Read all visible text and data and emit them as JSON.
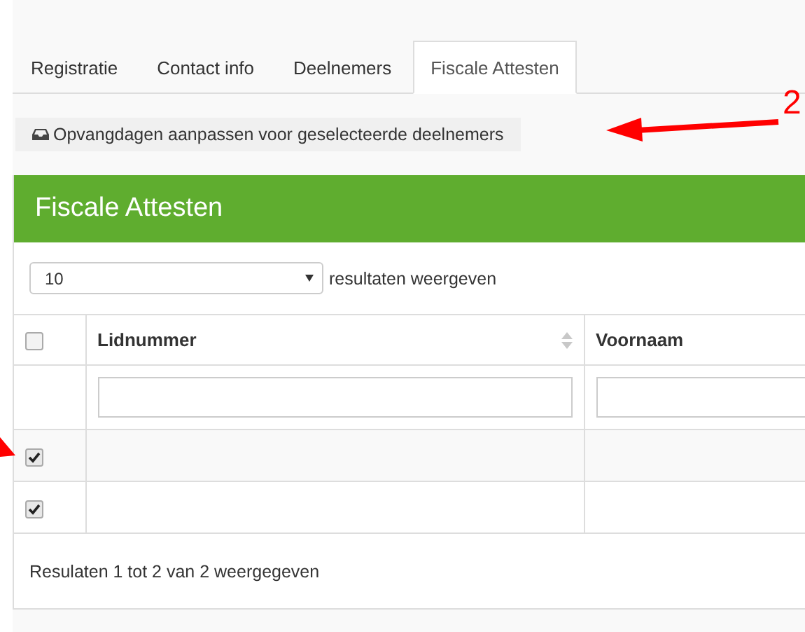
{
  "tabs": [
    {
      "label": "Registratie",
      "selected": false
    },
    {
      "label": "Contact info",
      "selected": false
    },
    {
      "label": "Deelnemers",
      "selected": false
    },
    {
      "label": "Fiscale Attesten",
      "selected": true
    }
  ],
  "action_button": {
    "label": "Opvangdagen aanpassen voor geselecteerde deelnemers"
  },
  "panel": {
    "title": "Fiscale Attesten",
    "page_size": {
      "value": "10",
      "label": "resultaten weergeven"
    },
    "table": {
      "select_all_checked": false,
      "columns": [
        {
          "label": "Lidnummer",
          "kind": "sortable"
        },
        {
          "label": "Voornaam",
          "kind": "plain"
        }
      ],
      "rows": [
        {
          "checked": true
        },
        {
          "checked": true
        }
      ]
    },
    "footer": "Resulaten 1 tot 2 van 2 weergegeven"
  },
  "annotation": {
    "label": "2"
  }
}
